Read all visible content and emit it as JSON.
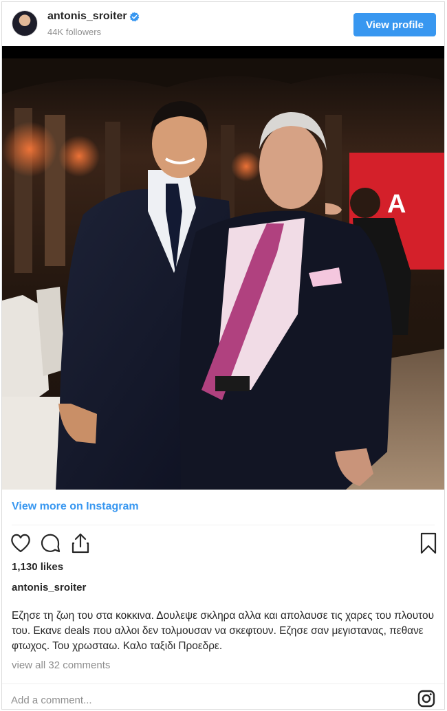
{
  "header": {
    "username": "antonis_sroiter",
    "followers": "44K followers",
    "view_profile_label": "View profile",
    "verified_icon": "verified-badge-icon",
    "accent_color": "#3897f0"
  },
  "photo": {
    "red_screen_text": "A"
  },
  "post": {
    "view_more_label": "View more on Instagram",
    "likes": "1,130 likes",
    "username": "antonis_sroiter",
    "caption": "Εζησε τη ζωη του στα κοκκινα. Δουλεψε σκληρα αλλα και απολαυσε τις χαρες του πλουτου του. Εκανε deals που αλλοι δεν τολμουσαν να σκεφτουν. Εζησε σαν μεγιστανας, πεθανε φτωχος. Του χρωσταω. Καλο ταξιδι Προεδρε.",
    "comments_label": "view all 32 comments",
    "add_comment_placeholder": "Add a comment...",
    "icons": [
      "heart-icon",
      "comment-icon",
      "share-icon",
      "bookmark-icon",
      "instagram-icon"
    ]
  }
}
